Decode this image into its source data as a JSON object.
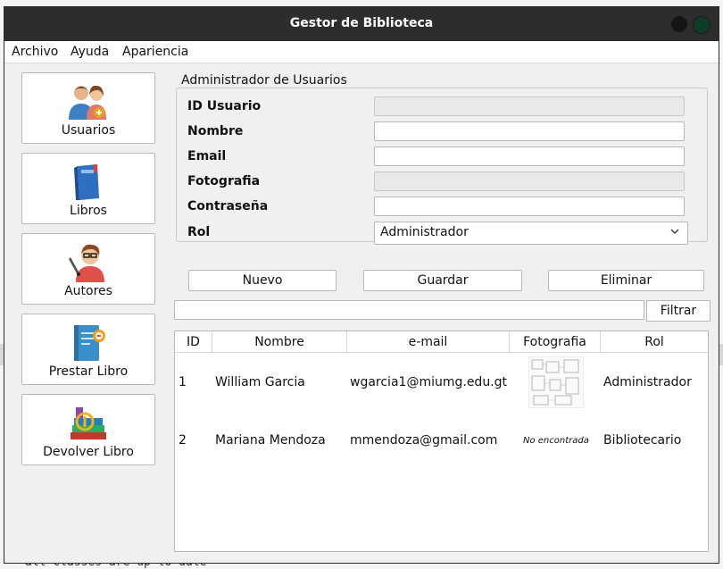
{
  "window": {
    "title": "Gestor de Biblioteca"
  },
  "menu": [
    "Archivo",
    "Ayuda",
    "Apariencia"
  ],
  "nav": [
    {
      "label": "Usuarios",
      "icon": "users-icon"
    },
    {
      "label": "Libros",
      "icon": "book-icon"
    },
    {
      "label": "Autores",
      "icon": "author-icon"
    },
    {
      "label": "Prestar Libro",
      "icon": "lend-book-icon"
    },
    {
      "label": "Devolver Libro",
      "icon": "return-book-icon"
    }
  ],
  "form": {
    "group_title": "Administrador de Usuarios",
    "fields": [
      {
        "label": "ID Usuario",
        "value": "",
        "disabled": true
      },
      {
        "label": "Nombre",
        "value": ""
      },
      {
        "label": "Email",
        "value": ""
      },
      {
        "label": "Fotografia",
        "value": "",
        "disabled": true
      },
      {
        "label": "Contraseña",
        "value": ""
      }
    ],
    "rol_label": "Rol",
    "rol_value": "Administrador"
  },
  "actions": {
    "new": "Nuevo",
    "save": "Guardar",
    "delete": "Eliminar"
  },
  "filter": {
    "value": "",
    "button": "Filtrar"
  },
  "table": {
    "headers": [
      "ID",
      "Nombre",
      "e-mail",
      "Fotografia",
      "Rol"
    ],
    "rows": [
      {
        "id": "1",
        "nombre": "William Garcia",
        "email": "wgarcia1@miumg.edu.gt",
        "foto": "",
        "rol": "Administrador"
      },
      {
        "id": "2",
        "nombre": "Mariana Mendoza",
        "email": "mmendoza@gmail.com",
        "foto": "No encontrada",
        "rol": "Bibliotecario"
      }
    ]
  },
  "background": {
    "bottom_text": "all classes are up to date"
  }
}
